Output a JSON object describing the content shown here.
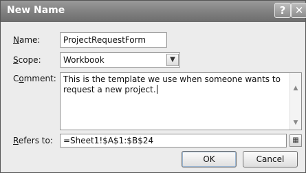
{
  "window": {
    "title": "New Name",
    "help_glyph": "?",
    "close_glyph": "✕"
  },
  "form": {
    "name_label_key": "N",
    "name_label_rest": "ame:",
    "name_value": "ProjectRequestForm",
    "scope_label_key": "S",
    "scope_label_rest": "cope:",
    "scope_value": "Workbook",
    "comment_label_pre": "C",
    "comment_label_key": "o",
    "comment_label_rest": "mment:",
    "comment_value": "This is the template we use when someone wants to request a new project.",
    "refers_label_key": "R",
    "refers_label_rest": "efers to:",
    "refers_value": "=Sheet1!$A$1:$B$24"
  },
  "buttons": {
    "ok": "OK",
    "cancel": "Cancel"
  },
  "icons": {
    "dropdown": "chevron-down-icon",
    "scroll_up": "scroll-up-icon",
    "scroll_down": "scroll-down-icon",
    "collapse": "collapse-dialog-icon"
  }
}
